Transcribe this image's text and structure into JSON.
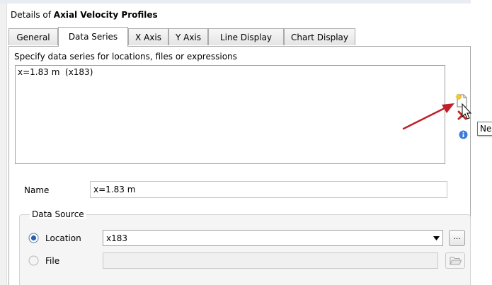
{
  "header": {
    "prefix": "Details of ",
    "object_name": "Axial Velocity Profiles"
  },
  "tabs": [
    {
      "label": "General"
    },
    {
      "label": "Data Series",
      "active": true
    },
    {
      "label": "X Axis"
    },
    {
      "label": "Y Axis"
    },
    {
      "label": "Line Display"
    },
    {
      "label": "Chart Display"
    }
  ],
  "series": {
    "instruction": "Specify data series for locations, files or expressions",
    "items": [
      "x=1.83 m  (x183)"
    ],
    "toolbar": {
      "new_icon": "new-document-icon",
      "delete_icon": "red-x-icon",
      "info_icon": "info-icon"
    },
    "tooltip": "New"
  },
  "name": {
    "label": "Name",
    "value": "x=1.83 m"
  },
  "data_source": {
    "title": "Data Source",
    "location": {
      "label": "Location",
      "selected": true,
      "value": "x183"
    },
    "file": {
      "label": "File",
      "selected": false,
      "value": ""
    },
    "ellipsis_label": "..."
  },
  "colors": {
    "annotation_arrow": "#c0202a",
    "tab_border": "#a9a9a9",
    "radio_selected": "#2a5fb0"
  }
}
